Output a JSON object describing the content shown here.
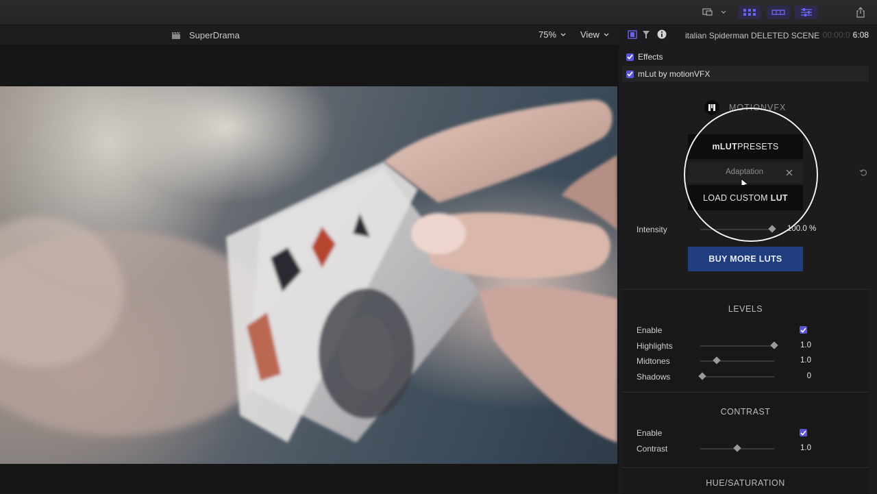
{
  "viewer": {
    "project_title": "SuperDrama",
    "zoom_label": "75%",
    "view_label": "View"
  },
  "inspector": {
    "clip_name": "italian Spiderman DELETED SCENE",
    "timecode_dim": "00:00:0",
    "timecode": "6:08",
    "effects_label": "Effects",
    "effect_name": "mLut by motionVFX",
    "brand": "MOTIONVFX",
    "presets_bold": "mLUT",
    "presets_rest": " PRESETS",
    "adaptation_label": "Adaptation",
    "load_rest": "LOAD CUSTOM ",
    "load_bold": "LUT",
    "intensity": {
      "label": "Intensity",
      "value": "100.0",
      "unit": "%",
      "fraction": 1.0
    },
    "buy_label": "BUY MORE LUTS",
    "levels": {
      "title": "LEVELS",
      "enable_label": "Enable",
      "highlights": {
        "label": "Highlights",
        "value": "1.0",
        "fraction": 1.0
      },
      "midtones": {
        "label": "Midtones",
        "value": "1.0",
        "fraction": 0.22
      },
      "shadows": {
        "label": "Shadows",
        "value": "0",
        "fraction": 0.03
      }
    },
    "contrast": {
      "title": "CONTRAST",
      "enable_label": "Enable",
      "contrast": {
        "label": "Contrast",
        "value": "1.0",
        "fraction": 0.5
      }
    },
    "hue_saturation": {
      "title": "HUE/SATURATION"
    }
  },
  "colors": {
    "accent": "#5b55d6",
    "blue_button": "#203e7d"
  }
}
